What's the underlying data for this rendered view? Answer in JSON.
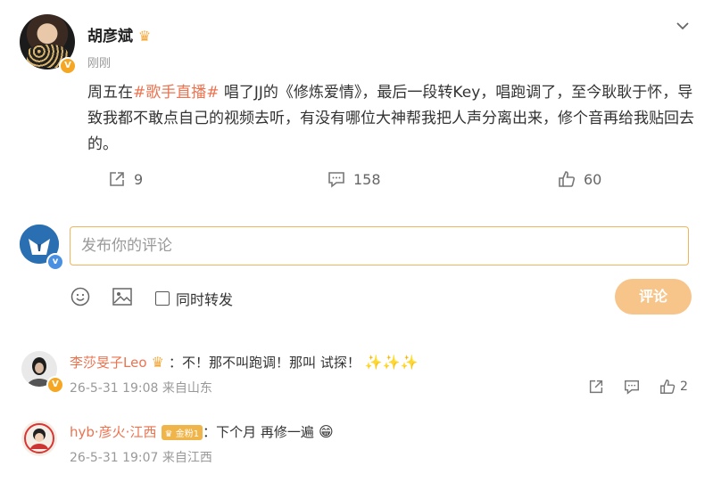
{
  "post": {
    "author": "胡彦斌",
    "author_badge_icon": "crown-icon",
    "time": "刚刚",
    "text_part1": "周五在",
    "hashtag": "#歌手直播#",
    "text_part2": " 唱了JJ的《修炼爱情》，最后一段转Key，唱跑调了，至今耿耿于怀，导致我都不敢点自己的视频去听，有没有哪位大神帮我把人声分离出来，修个音再给我贴回去的。",
    "repost_count": "9",
    "comment_count": "158",
    "like_count": "60"
  },
  "composer": {
    "placeholder": "发布你的评论",
    "repost_label": "同时转发",
    "submit_label": "评论"
  },
  "comments": [
    {
      "user": "李莎旻子Leo",
      "separator": "：",
      "text": "不！那不叫跑调！那叫 试探！",
      "emoji": "✨✨✨",
      "time": "26-5-31 19:08 来自山东",
      "like_count": "2"
    },
    {
      "user": "hyb·彦火·江西",
      "badge": "金粉1",
      "separator": "：",
      "text": "下个月 再修一遍",
      "emoji": "😁",
      "time": "26-5-31 19:07 来自江西"
    }
  ],
  "colors": {
    "accent": "#eb7350",
    "input_border": "#f2b45a",
    "button_bg": "#f7c48a",
    "verified": "#f5a623"
  }
}
